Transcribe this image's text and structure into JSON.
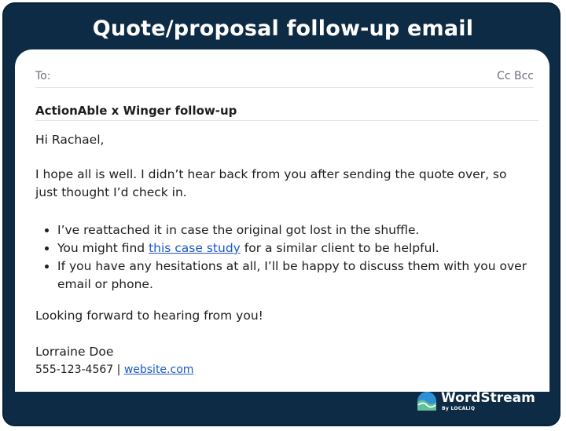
{
  "header": {
    "title": "Quote/proposal follow-up email"
  },
  "email": {
    "to_label": "To:",
    "cc_bcc": "Cc Bcc",
    "subject": "ActionAble x Winger follow-up",
    "greeting": "Hi Rachael,",
    "paragraph": "I hope all is well. I didn’t hear back from you after sending the quote over, so just thought I’d check in.",
    "bullets": {
      "b1": "I’ve reattached it in case the original got lost in the shuffle.",
      "b2_before": "You might find ",
      "b2_link": "this case study",
      "b2_after": " for a similar client to be helpful.",
      "b3": "If you have any hesitations at all, I’ll be happy to discuss them with you over email or phone."
    },
    "closing": "Looking forward to hearing from you!",
    "signature": {
      "name": "Lorraine Doe",
      "phone": "555-123-4567",
      "separator": " | ",
      "website": "website.com"
    }
  },
  "brand": {
    "name": "WordStream",
    "sub": "By LOCALiQ",
    "icon": "wave-logo-icon"
  },
  "colors": {
    "frame": "#0e2b45",
    "link": "#1a58c7",
    "logo_blue": "#2d8fd5",
    "logo_green": "#62c09a"
  }
}
